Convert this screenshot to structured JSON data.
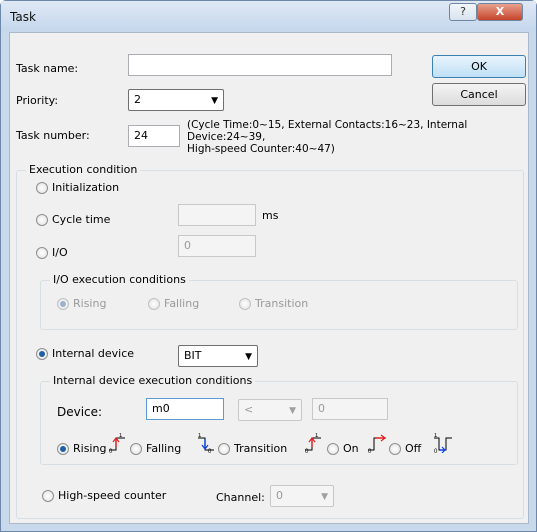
{
  "window": {
    "title": "Task",
    "help_glyph": "?",
    "close_glyph": "X"
  },
  "form": {
    "task_name_label": "Task name:",
    "task_name_value": "",
    "priority_label": "Priority:",
    "priority_value": "2",
    "task_number_label": "Task number:",
    "task_number_value": "24",
    "task_number_hint_1": "(Cycle Time:0~15, External Contacts:16~23, Internal",
    "task_number_hint_2": "Device:24~39,",
    "task_number_hint_3": "High-speed Counter:40~47)"
  },
  "buttons": {
    "ok": "OK",
    "cancel": "Cancel"
  },
  "execution": {
    "group_label": "Execution condition",
    "initialization": "Initialization",
    "cycle_time": "Cycle time",
    "cycle_time_value": "",
    "cycle_time_unit": "ms",
    "io": "I/O",
    "io_value": "0",
    "io_group_label": "I/O execution conditions",
    "io_conditions": [
      "Rising",
      "Falling",
      "Transition"
    ],
    "internal_device": "Internal device",
    "internal_device_type": "BIT",
    "internal_group_label": "Internal device execution conditions",
    "device_label": "Device:",
    "device_value": "m0",
    "compare_op": "<",
    "compare_value": "0",
    "internal_conditions": [
      "Rising",
      "Falling",
      "Transition",
      "On",
      "Off"
    ],
    "high_speed_counter": "High-speed counter",
    "channel_label": "Channel:",
    "channel_value": "0"
  },
  "selected": {
    "execution": "Internal device",
    "io_condition": "Rising",
    "internal_condition": "Rising"
  },
  "colors": {
    "signal_red": "#e02020",
    "signal_blue": "#1040e0",
    "title_bar": "#c5d7ec",
    "accent": "#3c7fb1"
  },
  "icons": [
    "help-icon",
    "close-icon",
    "dropdown-arrow-icon",
    "rising-edge-icon",
    "falling-edge-icon",
    "transition-icon",
    "on-level-icon",
    "off-level-icon"
  ]
}
